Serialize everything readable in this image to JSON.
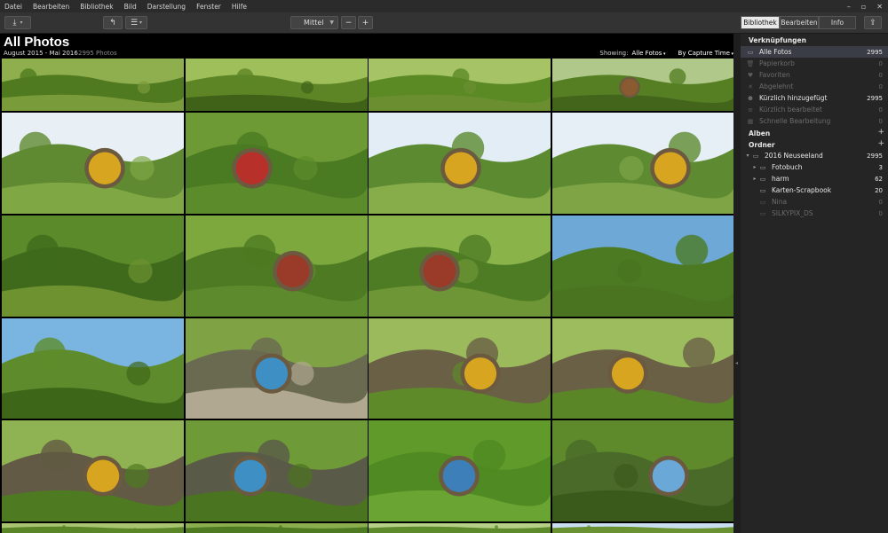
{
  "menu": [
    "Datei",
    "Bearbeiten",
    "Bibliothek",
    "Bild",
    "Darstellung",
    "Fenster",
    "Hilfe"
  ],
  "window_controls": [
    "–",
    "▫",
    "✕"
  ],
  "toolbar": {
    "zoom_value": "Mittel",
    "zoom_minus": "−",
    "zoom_plus": "+"
  },
  "mode_tabs": [
    {
      "label": "Bibliothek",
      "active": true
    },
    {
      "label": "Bearbeiten",
      "active": false
    },
    {
      "label": "Info",
      "active": false
    }
  ],
  "header": {
    "title": "All Photos",
    "date_range": "August 2015 - Mai 2016",
    "photo_count": "2995 Photos",
    "showing_label": "Showing:",
    "showing_value": "Alle Fotos",
    "sort_value": "By Capture Time"
  },
  "sidebar": {
    "shortcuts_title": "Verknüpfungen",
    "shortcuts": [
      {
        "label": "Alle Fotos",
        "count": "2995",
        "icon": "photos-icon",
        "glyph": "▭",
        "state": "selected"
      },
      {
        "label": "Papierkorb",
        "count": "0",
        "icon": "trash-icon",
        "glyph": "🗑",
        "state": "dim"
      },
      {
        "label": "Favoriten",
        "count": "0",
        "icon": "heart-icon",
        "glyph": "♥",
        "state": "dim"
      },
      {
        "label": "Abgelehnt",
        "count": "0",
        "icon": "reject-icon",
        "glyph": "✕",
        "state": "dim"
      },
      {
        "label": "Kürzlich hinzugefügt",
        "count": "2995",
        "icon": "recent-add-icon",
        "glyph": "⊕",
        "state": "bright"
      },
      {
        "label": "Kürzlich bearbeitet",
        "count": "0",
        "icon": "recent-edit-icon",
        "glyph": "≡",
        "state": "dim"
      },
      {
        "label": "Schnelle Bearbeitung",
        "count": "0",
        "icon": "quick-edit-icon",
        "glyph": "▦",
        "state": "dim"
      }
    ],
    "albums_title": "Alben",
    "albums_add": "+",
    "folders_title": "Ordner",
    "folders_add": "+",
    "folders": [
      {
        "label": "2016 Neuseeland",
        "count": "2995",
        "level": 0,
        "state": "bright",
        "twisty": "▾"
      },
      {
        "label": "Fotobuch",
        "count": "3",
        "level": 1,
        "state": "bright",
        "twisty": "▸"
      },
      {
        "label": "harm",
        "count": "62",
        "level": 1,
        "state": "bright",
        "twisty": "▸"
      },
      {
        "label": "Karten-Scrapbook",
        "count": "20",
        "level": 1,
        "state": "bright",
        "twisty": ""
      },
      {
        "label": "Nina",
        "count": "0",
        "level": 1,
        "state": "dim",
        "twisty": ""
      },
      {
        "label": "SILKYPIX_DS",
        "count": "0",
        "level": 1,
        "state": "dim",
        "twisty": ""
      }
    ]
  },
  "colors": {
    "accent_selected": "#3a3d45",
    "door_yellow": "#d8a520",
    "door_blue": "#3d8fc4",
    "door_red": "#b8302a",
    "grass": "#6d9a2f",
    "sky": "#d7e8f4"
  },
  "photos": [
    {
      "name": "hillside-path",
      "sky": "#8fae4e",
      "hill": "#4f7a1f",
      "fg": "#7a9b3a",
      "door": ""
    },
    {
      "name": "hill-lamp",
      "sky": "#9fbf5a",
      "hill": "#5d8526",
      "fg": "#3f6218",
      "door": ""
    },
    {
      "name": "garden-hill",
      "sky": "#a6c466",
      "hill": "#5b8a25",
      "fg": "#6b8f30",
      "door": ""
    },
    {
      "name": "hobbit-village",
      "sky": "#b0c98a",
      "hill": "#567f24",
      "fg": "#43651b",
      "door": "#8a5a30"
    },
    {
      "name": "tree-yellow-door",
      "sky": "#e8f0f6",
      "hill": "#5f8a32",
      "fg": "#7fa845",
      "door": "#d8a520"
    },
    {
      "name": "red-door-flowers",
      "sky": "#6d9a34",
      "hill": "#4a7a22",
      "fg": "#5c8b2b",
      "door": "#b8302a"
    },
    {
      "name": "tree-yellow-door-2",
      "sky": "#e2edf5",
      "hill": "#5c8a30",
      "fg": "#86ad4a",
      "door": "#d8a520"
    },
    {
      "name": "tree-yellow-door-3",
      "sky": "#e6eff6",
      "hill": "#5e8b32",
      "fg": "#7ea446",
      "door": "#d8a520"
    },
    {
      "name": "garden-bench",
      "sky": "#5a8a2a",
      "hill": "#3f6a1c",
      "fg": "#6e9230",
      "door": ""
    },
    {
      "name": "lamp-red-door",
      "sky": "#7da83e",
      "hill": "#4d7a22",
      "fg": "#5d8a2c",
      "door": "#9a3a28"
    },
    {
      "name": "lamp-garden",
      "sky": "#8ab34a",
      "hill": "#4e7c24",
      "fg": "#6f9636",
      "door": "#9a3a28"
    },
    {
      "name": "tree-sky",
      "sky": "#6ea8d6",
      "hill": "#4c7a23",
      "fg": "#4a7420",
      "door": ""
    },
    {
      "name": "hill-blue-sky",
      "sky": "#7ab4e0",
      "hill": "#5e8c2c",
      "fg": "#3e6618",
      "door": ""
    },
    {
      "name": "blue-door-fence",
      "sky": "#7fa245",
      "hill": "#6a6a50",
      "fg": "#b0a890",
      "door": "#3d8fc4"
    },
    {
      "name": "yellow-door-bench",
      "sky": "#9aba5c",
      "hill": "#6a6046",
      "fg": "#5e8a2a",
      "door": "#d8a520"
    },
    {
      "name": "yellow-door-bench-2",
      "sky": "#9cbc5e",
      "hill": "#6a6046",
      "fg": "#5a8628",
      "door": "#d8a520"
    },
    {
      "name": "yellow-door-garden",
      "sky": "#8fb352",
      "hill": "#625a44",
      "fg": "#4e7a22",
      "door": "#d8a520"
    },
    {
      "name": "signpost-blue-door",
      "sky": "#6f9a38",
      "hill": "#5a5a48",
      "fg": "#4a7420",
      "door": "#3d8fc4"
    },
    {
      "name": "grass-blue-door",
      "sky": "#5f9a2a",
      "hill": "#4f8a22",
      "fg": "#6aa432",
      "door": "#3d7fb8"
    },
    {
      "name": "blue-door-round",
      "sky": "#5e8a2c",
      "hill": "#4a6a2a",
      "fg": "#3a5a1c",
      "door": "#6aa8d8"
    },
    {
      "name": "partial-1",
      "sky": "#a8c470",
      "hill": "#5a8628",
      "fg": "#5a8628",
      "door": ""
    },
    {
      "name": "partial-2",
      "sky": "#8aae4e",
      "hill": "#4e7a22",
      "fg": "#4e7a22",
      "door": ""
    },
    {
      "name": "partial-3",
      "sky": "#b5cf86",
      "hill": "#5d8a2a",
      "fg": "#5d8a2a",
      "door": ""
    },
    {
      "name": "partial-4",
      "sky": "#c8ddef",
      "hill": "#6a9232",
      "fg": "#6a9232",
      "door": ""
    }
  ]
}
